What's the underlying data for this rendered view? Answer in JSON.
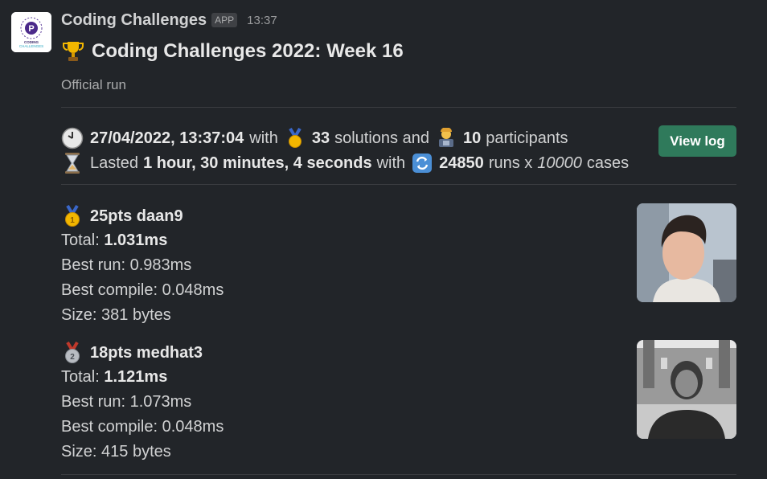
{
  "app": {
    "name": "Coding Challenges",
    "badge": "APP",
    "time": "13:37",
    "logo_text_1": "CODING",
    "logo_text_2": "CHALLENGES"
  },
  "message": {
    "title": "Coding Challenges 2022: Week 16",
    "subtitle": "Official run"
  },
  "summary": {
    "datetime": "27/04/2022, 13:37:04",
    "with_text": "with",
    "solutions_count": "33",
    "solutions_text": "solutions and",
    "participants_count": "10",
    "participants_text": "participants",
    "lasted_text": "Lasted",
    "duration": "1 hour, 30 minutes, 4 seconds",
    "with_text_2": "with",
    "runs_count": "24850",
    "runs_text": "runs x",
    "cases_count": "10000",
    "cases_text": "cases",
    "view_log_label": "View log"
  },
  "entries": [
    {
      "heading": "25pts daan9",
      "total_label": "Total:",
      "total_value": "1.031ms",
      "best_run": "Best run: 0.983ms",
      "best_compile": "Best compile: 0.048ms",
      "size": "Size: 381 bytes"
    },
    {
      "heading": "18pts medhat3",
      "total_label": "Total:",
      "total_value": "1.121ms",
      "best_run": "Best run: 1.073ms",
      "best_compile": "Best compile: 0.048ms",
      "size": "Size: 415 bytes"
    }
  ],
  "colors": {
    "button": "#2f7a5b",
    "background": "#222529",
    "gold": "#f2b600",
    "silver": "#b8bcc2"
  }
}
